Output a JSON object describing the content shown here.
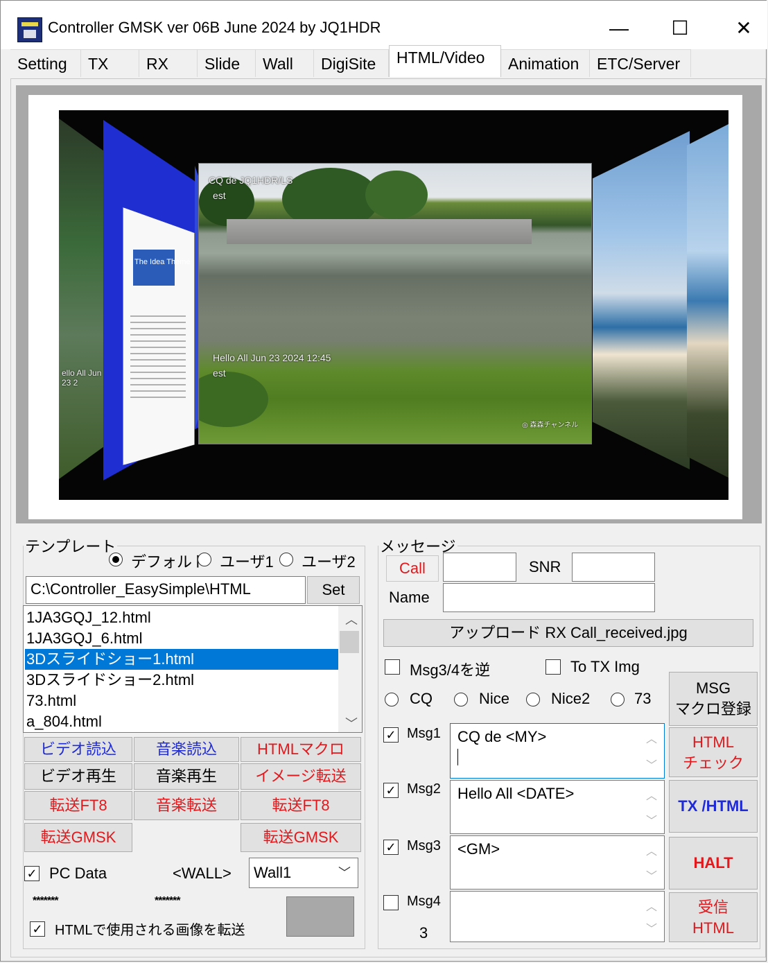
{
  "window": {
    "title": "Controller GMSK ver 06B June 2024 by JQ1HDR",
    "controls": {
      "minimize": "—",
      "maximize": "☐",
      "close": "✕"
    }
  },
  "tabs": [
    "Setting",
    "TX",
    "RX",
    "Slide",
    "Wall",
    "DigiSite",
    "HTML/Video",
    "Animation",
    "ETC/Server"
  ],
  "active_tab": "HTML/Video",
  "preview": {
    "overlay_top": "CQ de JQ1HDR/LS",
    "overlay_top2": "est",
    "overlay_bottom": "Hello All Jun 23 2024 12:45",
    "overlay_bottom2": "est",
    "watermark": "◎ 森森チャンネル",
    "side_overlay": "ello All Jun 23 2",
    "doc_title": "The Idea Theme"
  },
  "template": {
    "legend": "テンプレート",
    "radio_default": "デフォルト",
    "radio_user1": "ユーザ1",
    "radio_user2": "ユーザ2",
    "path": "C:\\Controller_EasySimple\\HTML",
    "set_button": "Set",
    "files": [
      "1JA3GQJ_12.html",
      "1JA3GQJ_6.html",
      "3Dスライドショー1.html",
      "3Dスライドショー2.html",
      "73.html",
      "a_804.html"
    ],
    "selected_file": "3Dスライドショー1.html",
    "buttons": {
      "video_load": "ビデオ読込",
      "music_load": "音楽読込",
      "html_macro": "HTMLマクロ",
      "video_play": "ビデオ再生",
      "music_play": "音楽再生",
      "image_send": "イメージ転送",
      "send_ft8_1": "転送FT8",
      "music_send": "音楽転送",
      "send_ft8_2": "転送FT8",
      "send_gmsk_1": "転送GMSK",
      "send_gmsk_2": "転送GMSK"
    },
    "pc_data_label": "PC Data",
    "wall_label": "<WALL>",
    "wall_select": "Wall1",
    "stars1": "*******",
    "stars2": "*******",
    "send_images_label": "HTMLで使用される画像を転送"
  },
  "message": {
    "legend": "メッセージ",
    "call_button": "Call",
    "call_value": "",
    "snr_label": "SNR",
    "snr_value": "",
    "name_label": "Name",
    "name_value": "",
    "upload_button": "アップロード RX  Call_received.jpg",
    "msg34_reverse": "Msg3/4を逆",
    "to_tx_img": "To TX Img",
    "radio_cq": "CQ",
    "radio_nice": "Nice",
    "radio_nice2": "Nice2",
    "radio_73": "73",
    "msg1_label": "Msg1",
    "msg1_text": "CQ de <MY>",
    "msg2_label": "Msg2",
    "msg2_text": "Hello All <DATE>",
    "msg3_label": "Msg3",
    "msg3_text": "<GM>",
    "msg4_label": "Msg4",
    "msg4_text": "",
    "counter": "3"
  },
  "side_buttons": {
    "msg_macro_line1": "MSG",
    "msg_macro_line2": "マクロ登録",
    "html_check_line1": "HTML",
    "html_check_line2": "チェック",
    "tx_html": "TX /HTML",
    "halt": "HALT",
    "recv_html_line1": "受信",
    "recv_html_line2": "HTML"
  },
  "colors": {
    "accent_red": "#e2181c",
    "accent_blue": "#1f2bd6",
    "selection": "#0078d7"
  }
}
